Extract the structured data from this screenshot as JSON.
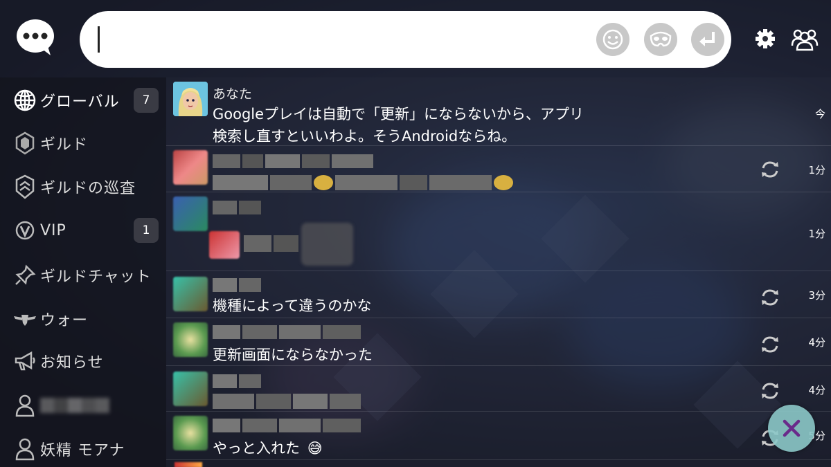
{
  "input": {
    "placeholder": ""
  },
  "sidebar": {
    "items": [
      {
        "label": "グローバル",
        "badge": "7",
        "icon": "globe-icon"
      },
      {
        "label": "ギルド",
        "icon": "guild-emblem-icon"
      },
      {
        "label": "ギルドの巡査",
        "icon": "guild-shield-icon"
      },
      {
        "label": "VIP",
        "badge": "1",
        "icon": "vip-icon"
      },
      {
        "label": "ギルドチャット",
        "icon": "pin-icon"
      },
      {
        "label": "ウォー",
        "icon": "winged-crest-icon"
      },
      {
        "label": "お知らせ",
        "icon": "megaphone-icon"
      },
      {
        "label": "",
        "icon": "person-icon"
      },
      {
        "label": "妖精 モアナ",
        "icon": "person-icon"
      }
    ]
  },
  "messages": [
    {
      "name": "あなた",
      "lines": [
        "Googleプレイは自動で「更新」にならないから、アプリ",
        "検索し直すといいわよ。そうAndroidならね。"
      ],
      "time": "今"
    },
    {
      "name": "",
      "lines": [
        ""
      ],
      "time": "1分"
    },
    {
      "name": "",
      "lines": [
        ""
      ],
      "time": "1分"
    },
    {
      "name": "",
      "lines": [
        "機種によって違うのかな"
      ],
      "time": "3分"
    },
    {
      "name": "",
      "lines": [
        "更新画面にならなかった"
      ],
      "time": "4分"
    },
    {
      "name": "",
      "lines": [
        ""
      ],
      "time": "4分"
    },
    {
      "name": "",
      "lines": [
        "やっと入れた"
      ],
      "time": "5分",
      "emoji": "😅"
    }
  ],
  "colors": {
    "close_accent": "#6a2a8a",
    "input_bg": "#ffffff",
    "badge_bg": "#3a3b44"
  }
}
